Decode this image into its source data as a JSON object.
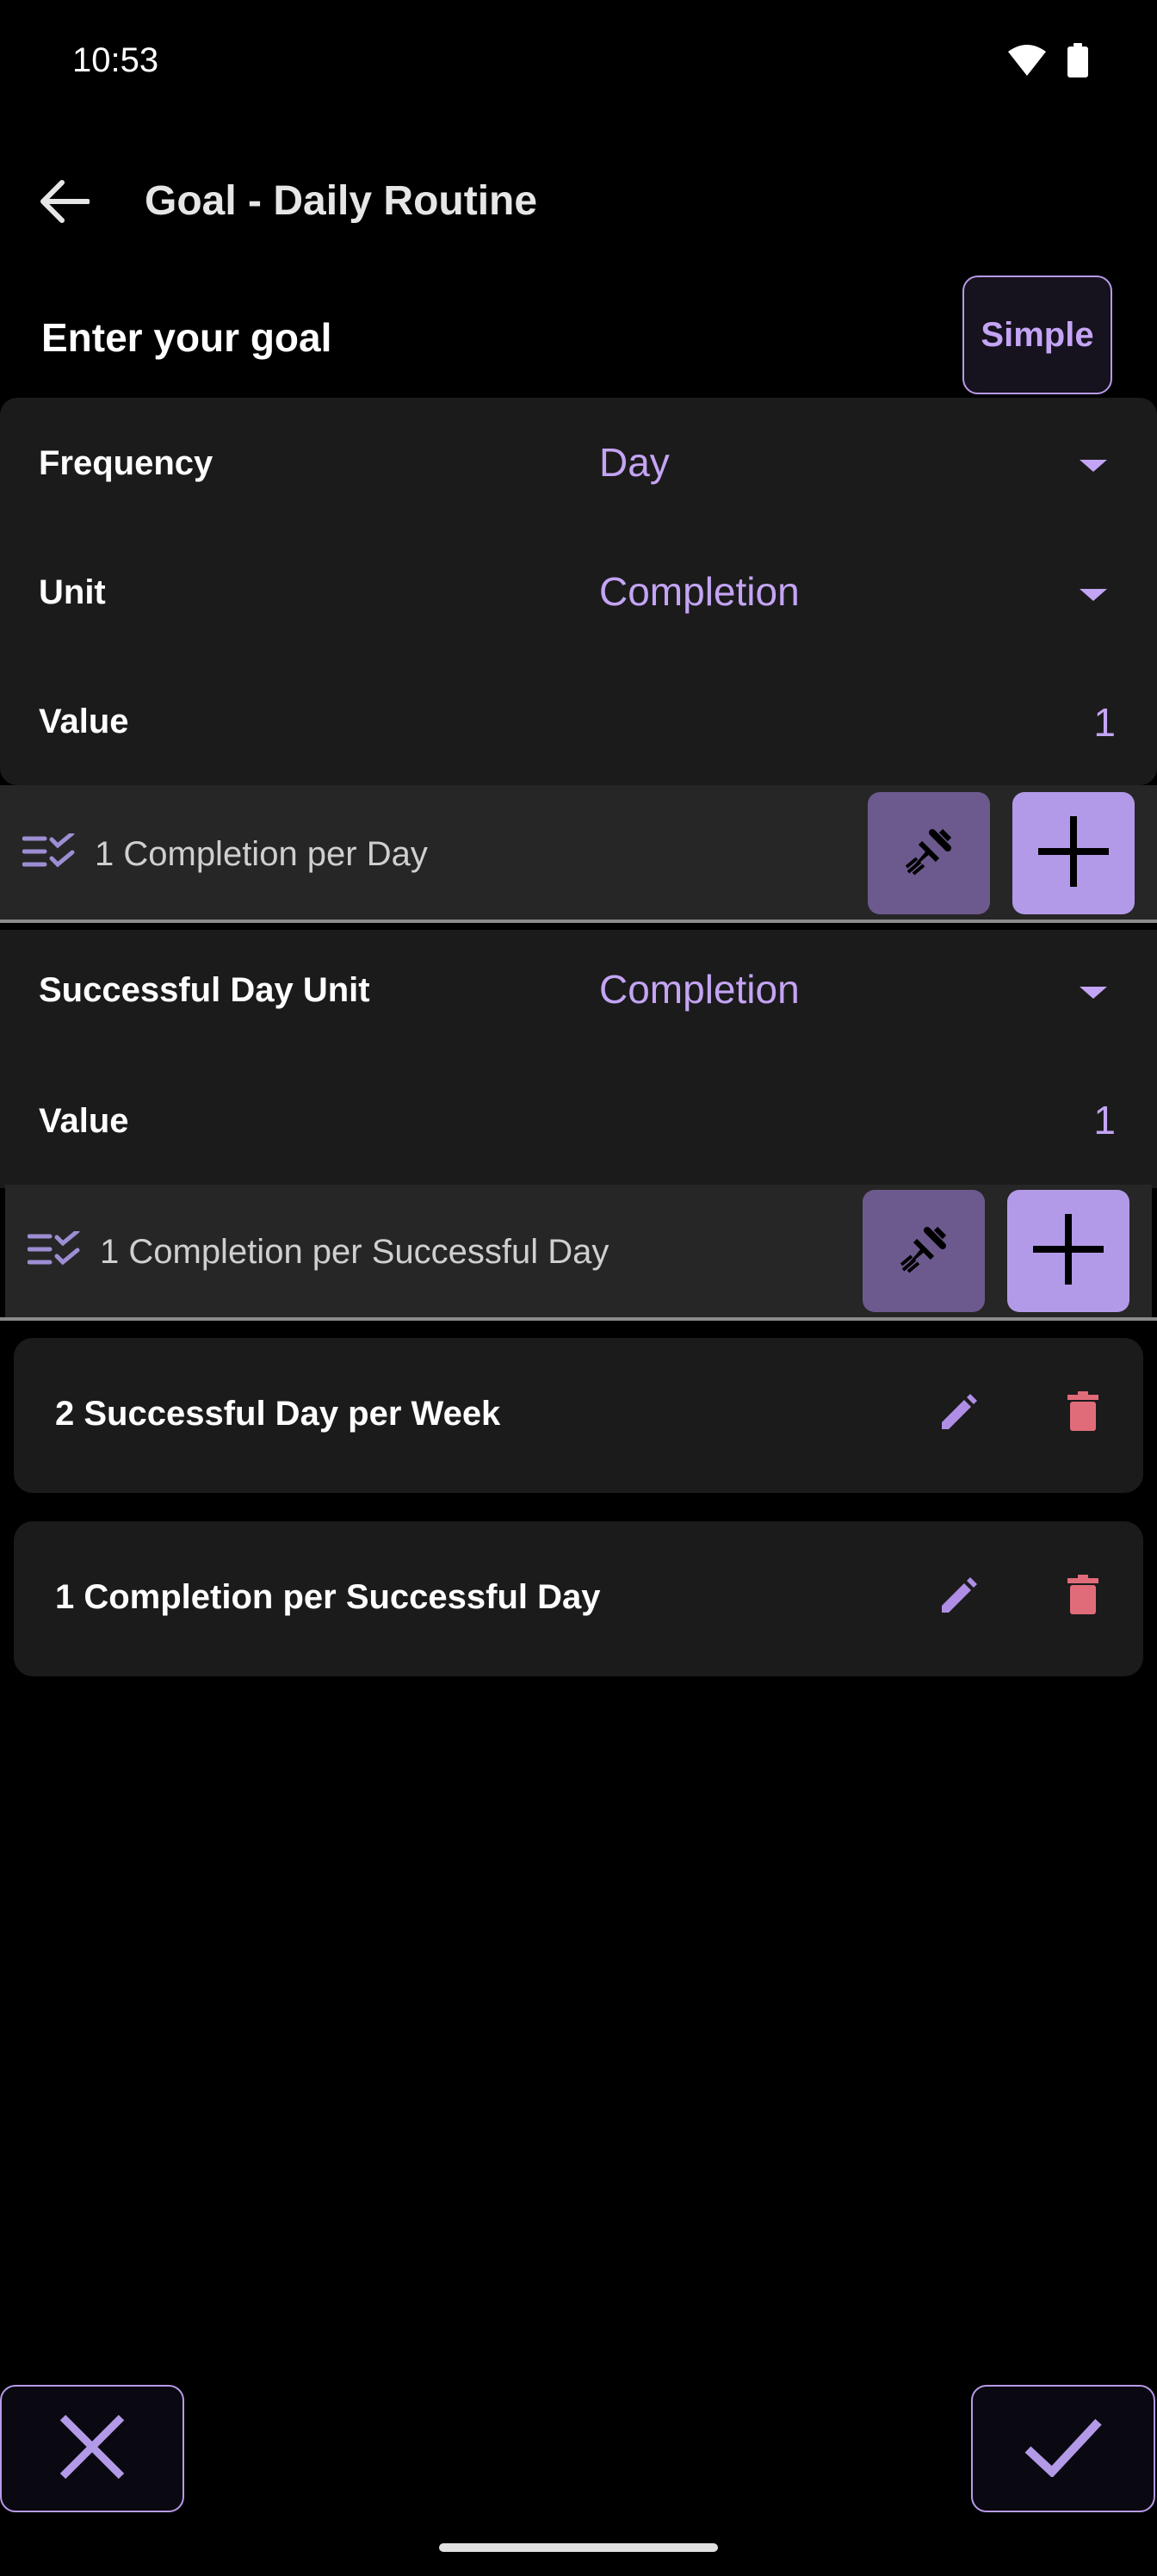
{
  "status_bar": {
    "time": "10:53",
    "icons": [
      "wifi-icon",
      "battery-icon"
    ]
  },
  "app_bar": {
    "title": "Goal - Daily Routine",
    "back_icon": "arrow-back-icon"
  },
  "header": {
    "heading": "Enter your goal",
    "simple_button": "Simple"
  },
  "frequency_section": {
    "frequency_label": "Frequency",
    "frequency_value": "Day",
    "unit_label": "Unit",
    "unit_value": "Completion",
    "value_label": "Value",
    "value_value": "1",
    "summary": "1 Completion per Day"
  },
  "successful_day_section": {
    "unit_label": "Successful Day Unit",
    "unit_value": "Completion",
    "value_label": "Value",
    "value_value": "1",
    "summary": "1 Completion per Successful Day"
  },
  "goals_list": [
    {
      "text": "2 Successful Day per Week"
    },
    {
      "text": "1 Completion per Successful Day"
    }
  ],
  "colors": {
    "accent": "#c4a4f4",
    "accent_button": "#b39ae8",
    "tool_button": "#6c5a8e",
    "delete": "#e06c7a",
    "card": "#1b1b1b",
    "background": "#000000"
  },
  "bottom_actions": {
    "cancel_icon": "close-icon",
    "confirm_icon": "check-icon"
  }
}
